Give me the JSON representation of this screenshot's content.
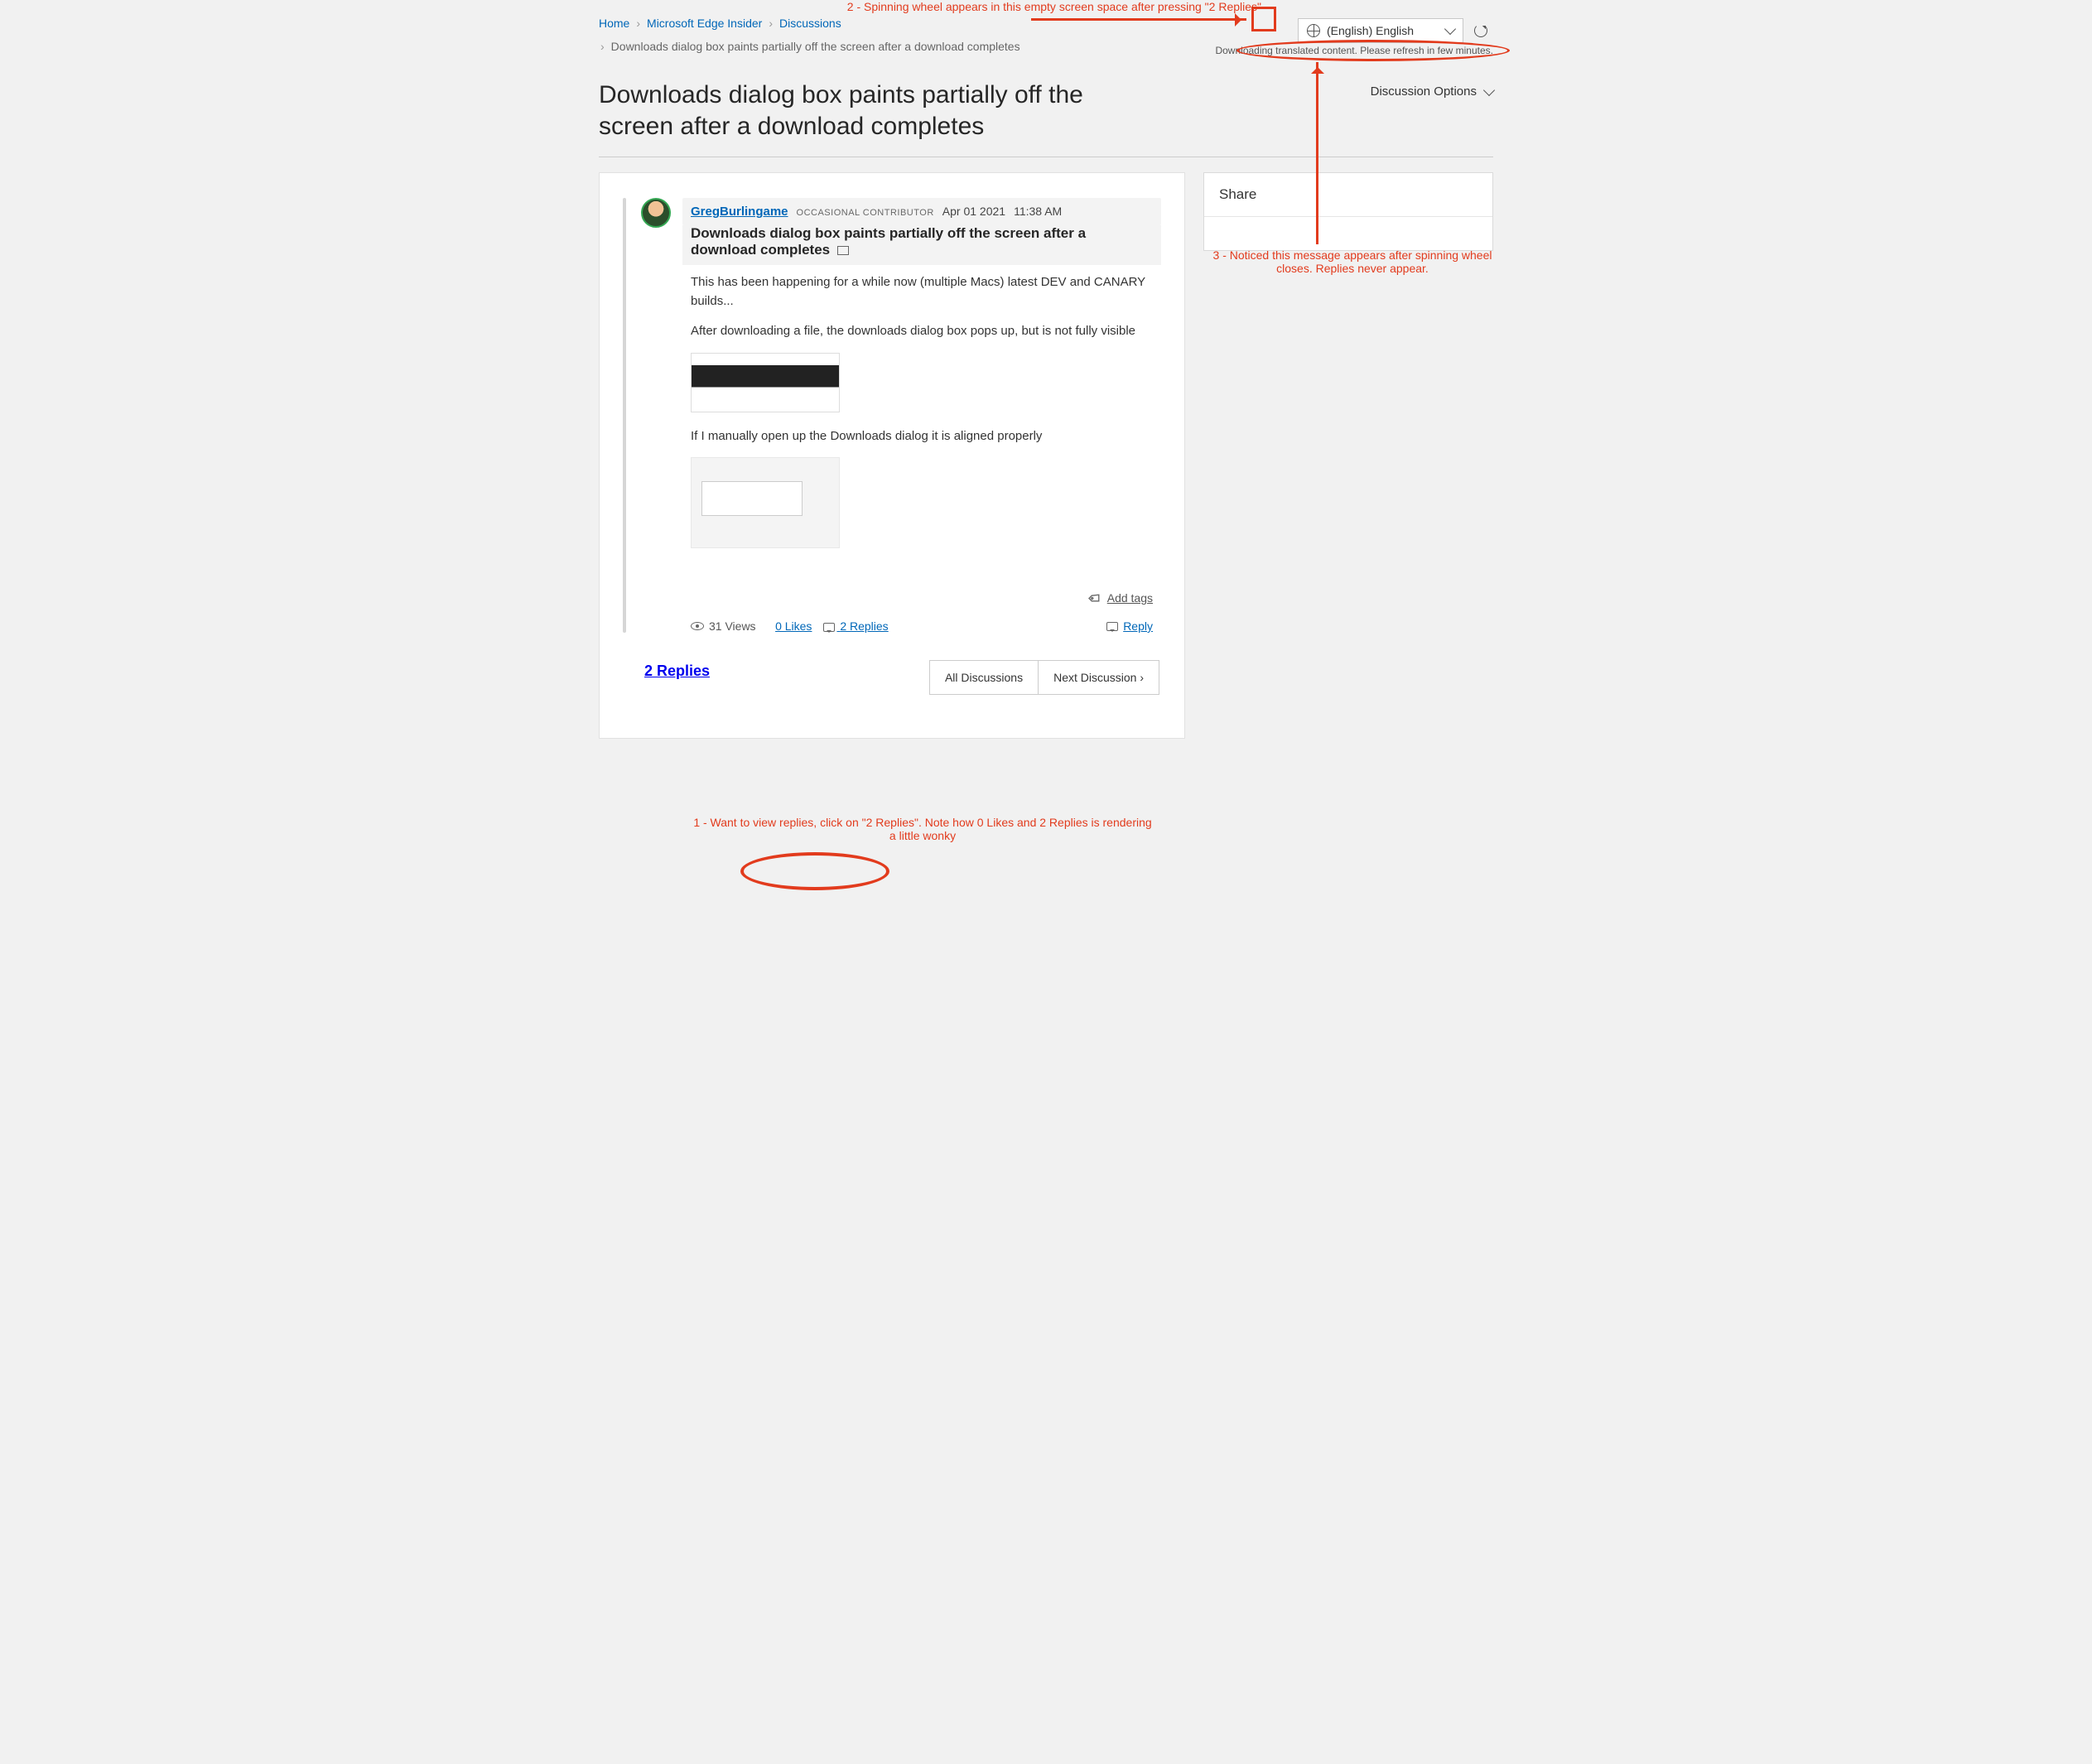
{
  "breadcrumbs": {
    "home": "Home",
    "community": "Microsoft Edge Insider",
    "board": "Discussions",
    "current": "Downloads dialog box paints partially off the screen after a download completes"
  },
  "language": {
    "label": "(English) English"
  },
  "translateMessage": "Downloading translated content. Please refresh in few minutes.",
  "pageTitle": "Downloads dialog box paints partially off the screen after a download completes",
  "discussionOptions": "Discussion Options",
  "post": {
    "author": "GregBurlingame",
    "rank": "OCCASIONAL CONTRIBUTOR",
    "date": "Apr 01 2021",
    "time": "11:38 AM",
    "title": "Downloads dialog box paints partially off the screen after a download completes",
    "p1": "This has been happening for a while now (multiple Macs) latest DEV and CANARY builds...",
    "p2": "After downloading a file, the downloads dialog box pops up, but is not fully visible",
    "p3": "If I manually open up the Downloads dialog it is aligned properly"
  },
  "tags": {
    "addTags": "Add tags"
  },
  "footer": {
    "viewsCount": "31 Views",
    "likes": "0 Likes",
    "replies": "2 Replies",
    "replyAction": "Reply"
  },
  "repliesHeading": "2 Replies",
  "nav": {
    "all": "All Discussions",
    "next": "Next Discussion  ›"
  },
  "sidebar": {
    "shareTitle": "Share"
  },
  "annotations": {
    "a1": "1 - Want to view replies, click on \"2 Replies\".  Note how 0 Likes and 2 Replies is rendering a little wonky",
    "a2": "2 - Spinning wheel appears in this empty screen space after pressing \"2 Replies\"",
    "a3": "3 - Noticed this message appears after spinning wheel closes.  Replies never appear."
  }
}
